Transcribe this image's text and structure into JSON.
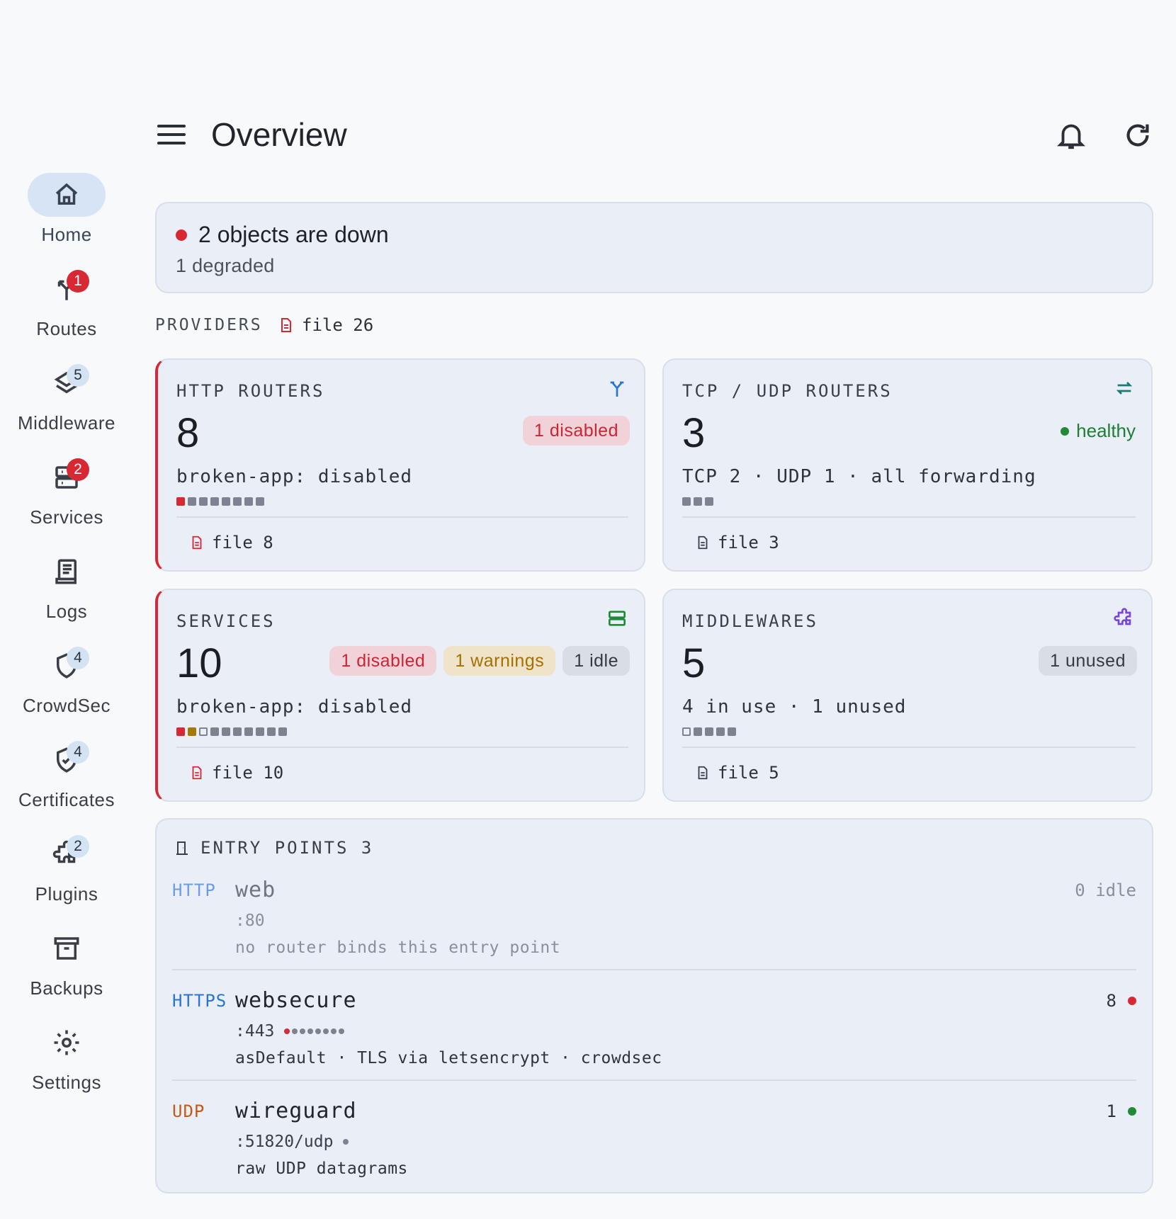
{
  "header": {
    "title": "Overview"
  },
  "nav": [
    {
      "label": "Home",
      "icon": "home-icon",
      "active": true,
      "badge": ""
    },
    {
      "label": "Routes",
      "icon": "routes-icon",
      "badge": "1",
      "badge_color": "red"
    },
    {
      "label": "Middleware",
      "icon": "layers-icon",
      "badge": "5",
      "badge_color": "blue"
    },
    {
      "label": "Services",
      "icon": "server-icon",
      "badge": "2",
      "badge_color": "red"
    },
    {
      "label": "Logs",
      "icon": "logs-icon",
      "badge": ""
    },
    {
      "label": "CrowdSec",
      "icon": "shield-icon",
      "badge": "4",
      "badge_color": "blue"
    },
    {
      "label": "Certificates",
      "icon": "shield-check-icon",
      "badge": "4",
      "badge_color": "blue"
    },
    {
      "label": "Plugins",
      "icon": "puzzle-icon",
      "badge": "2",
      "badge_color": "blue"
    },
    {
      "label": "Backups",
      "icon": "archive-icon",
      "badge": ""
    },
    {
      "label": "Settings",
      "icon": "gear-icon",
      "badge": ""
    }
  ],
  "alert": {
    "title": "2 objects are down",
    "subtitle": "1 degraded"
  },
  "providers": {
    "label": "PROVIDERS",
    "chip": "file 26"
  },
  "cards": {
    "http": {
      "title": "HTTP ROUTERS",
      "count": "8",
      "pill": "1 disabled",
      "sub": "broken-app: disabled",
      "file": "file 8",
      "squares": [
        "red",
        "gray",
        "gray",
        "gray",
        "gray",
        "gray",
        "gray",
        "gray"
      ]
    },
    "tcp": {
      "title": "TCP / UDP ROUTERS",
      "count": "3",
      "status": "healthy",
      "sub": "TCP 2 · UDP 1 · all forwarding",
      "file": "file 3",
      "squares": [
        "gray",
        "gray",
        "gray"
      ]
    },
    "services": {
      "title": "SERVICES",
      "count": "10",
      "pills": [
        "1 disabled",
        "1 warnings",
        "1 idle"
      ],
      "sub": "broken-app: disabled",
      "file": "file 10",
      "squares": [
        "red",
        "yellow",
        "hollow",
        "gray",
        "gray",
        "gray",
        "gray",
        "gray",
        "gray",
        "gray"
      ]
    },
    "middlewares": {
      "title": "MIDDLEWARES",
      "count": "5",
      "pill": "1 unused",
      "sub": "4 in use · 1 unused",
      "file": "file 5",
      "squares": [
        "hollow",
        "gray",
        "gray",
        "gray",
        "gray"
      ]
    }
  },
  "entry_points": {
    "title": "ENTRY POINTS 3",
    "items": [
      {
        "proto": "HTTP",
        "name": "web",
        "port": ":80",
        "desc": "no router binds this entry point",
        "right": "0 idle",
        "dim": true
      },
      {
        "proto": "HTTPS",
        "name": "websecure",
        "port": ":443",
        "desc": "asDefault · TLS via letsencrypt · crowdsec",
        "right": "8",
        "status": "red"
      },
      {
        "proto": "UDP",
        "name": "wireguard",
        "port": ":51820/udp",
        "desc": "raw UDP datagrams",
        "right": "1",
        "status": "green"
      }
    ]
  },
  "colors": {
    "accent": "#d6e4f5",
    "danger": "#d72833",
    "success": "#1f8a38",
    "warning": "#a47100",
    "http": "#6f9ce0",
    "https": "#2a74d4",
    "udp": "#c45a18"
  }
}
